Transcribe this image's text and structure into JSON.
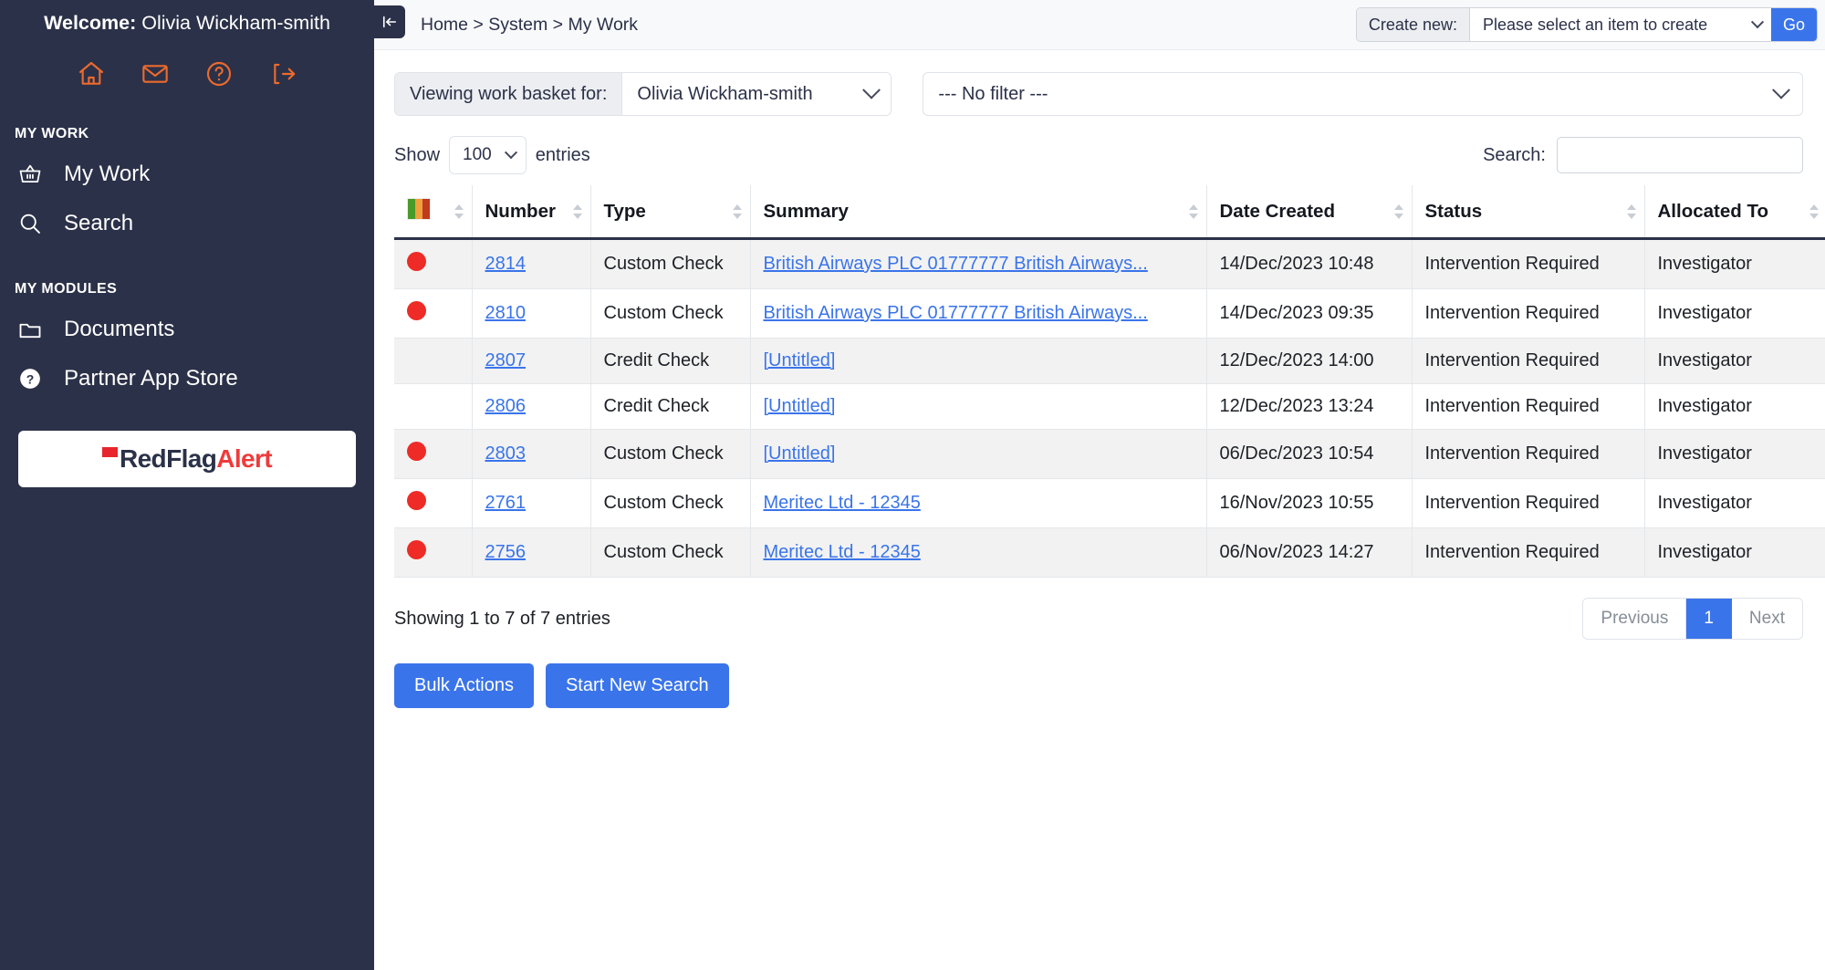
{
  "sidebar": {
    "welcome_label": "Welcome:",
    "welcome_user": "Olivia Wickham-smith",
    "quick_icons": [
      {
        "name": "home-icon",
        "title": "Home"
      },
      {
        "name": "mail-icon",
        "title": "Messages"
      },
      {
        "name": "help-icon",
        "title": "Help"
      },
      {
        "name": "logout-icon",
        "title": "Log out"
      }
    ],
    "sections": [
      {
        "title": "MY WORK",
        "items": [
          {
            "label": "My Work",
            "icon": "basket-icon"
          },
          {
            "label": "Search",
            "icon": "search-icon"
          }
        ]
      },
      {
        "title": "MY MODULES",
        "items": [
          {
            "label": "Documents",
            "icon": "folder-icon"
          },
          {
            "label": "Partner App Store",
            "icon": "question-circle-icon"
          }
        ]
      }
    ],
    "logo": {
      "part1": "RedFlag",
      "part2": "Alert",
      "color1": "#2b3148",
      "color2": "#ef3b3b",
      "mark_color": "#e8252c"
    }
  },
  "topbar": {
    "collapse_icon": "collapse-sidebar-icon",
    "breadcrumb": "Home > System > My Work",
    "create_new_label": "Create new:",
    "create_new_value": "Please select an item to create",
    "go_label": "Go"
  },
  "filters": {
    "basket_label": "Viewing work basket for:",
    "basket_value": "Olivia Wickham-smith",
    "filter_value": "--- No filter ---"
  },
  "table_controls": {
    "show_label": "Show",
    "entries_value": "100",
    "entries_label": "entries",
    "search_label": "Search:",
    "search_value": "",
    "search_placeholder": ""
  },
  "table": {
    "columns": [
      {
        "label": "",
        "icon": "rag-status-icon",
        "sortable": true
      },
      {
        "label": "Number",
        "sortable": true
      },
      {
        "label": "Type",
        "sortable": true
      },
      {
        "label": "Summary",
        "sortable": true
      },
      {
        "label": "Date Created",
        "sortable": true
      },
      {
        "label": "Status",
        "sortable": true
      },
      {
        "label": "Allocated To",
        "sortable": true
      }
    ],
    "rag_colors": [
      "#4a9a2a",
      "#f0a03c",
      "#c03a1e"
    ],
    "dot_color": "#ee2b26",
    "rows": [
      {
        "flag": true,
        "number": "2814",
        "type": "Custom Check",
        "summary": "British Airways PLC 01777777 British Airways...",
        "date": "14/Dec/2023 10:48",
        "status": "Intervention Required",
        "allocated": "Investigator"
      },
      {
        "flag": true,
        "number": "2810",
        "type": "Custom Check",
        "summary": "British Airways PLC 01777777 British Airways...",
        "date": "14/Dec/2023 09:35",
        "status": "Intervention Required",
        "allocated": "Investigator"
      },
      {
        "flag": false,
        "number": "2807",
        "type": "Credit Check",
        "summary": "[Untitled]",
        "date": "12/Dec/2023 14:00",
        "status": "Intervention Required",
        "allocated": "Investigator"
      },
      {
        "flag": false,
        "number": "2806",
        "type": "Credit Check",
        "summary": "[Untitled]",
        "date": "12/Dec/2023 13:24",
        "status": "Intervention Required",
        "allocated": "Investigator"
      },
      {
        "flag": true,
        "number": "2803",
        "type": "Custom Check",
        "summary": "[Untitled]",
        "date": "06/Dec/2023 10:54",
        "status": "Intervention Required",
        "allocated": "Investigator"
      },
      {
        "flag": true,
        "number": "2761",
        "type": "Custom Check",
        "summary": "Meritec Ltd - 12345",
        "date": "16/Nov/2023 10:55",
        "status": "Intervention Required",
        "allocated": "Investigator"
      },
      {
        "flag": true,
        "number": "2756",
        "type": "Custom Check",
        "summary": "Meritec Ltd - 12345",
        "date": "06/Nov/2023 14:27",
        "status": "Intervention Required",
        "allocated": "Investigator"
      }
    ]
  },
  "footer": {
    "entries_info": "Showing 1 to 7 of 7 entries",
    "pager": {
      "previous": "Previous",
      "page": "1",
      "next": "Next"
    },
    "buttons": [
      {
        "label": "Bulk Actions",
        "name": "bulk-actions-button"
      },
      {
        "label": "Start New Search",
        "name": "start-new-search-button"
      }
    ]
  }
}
